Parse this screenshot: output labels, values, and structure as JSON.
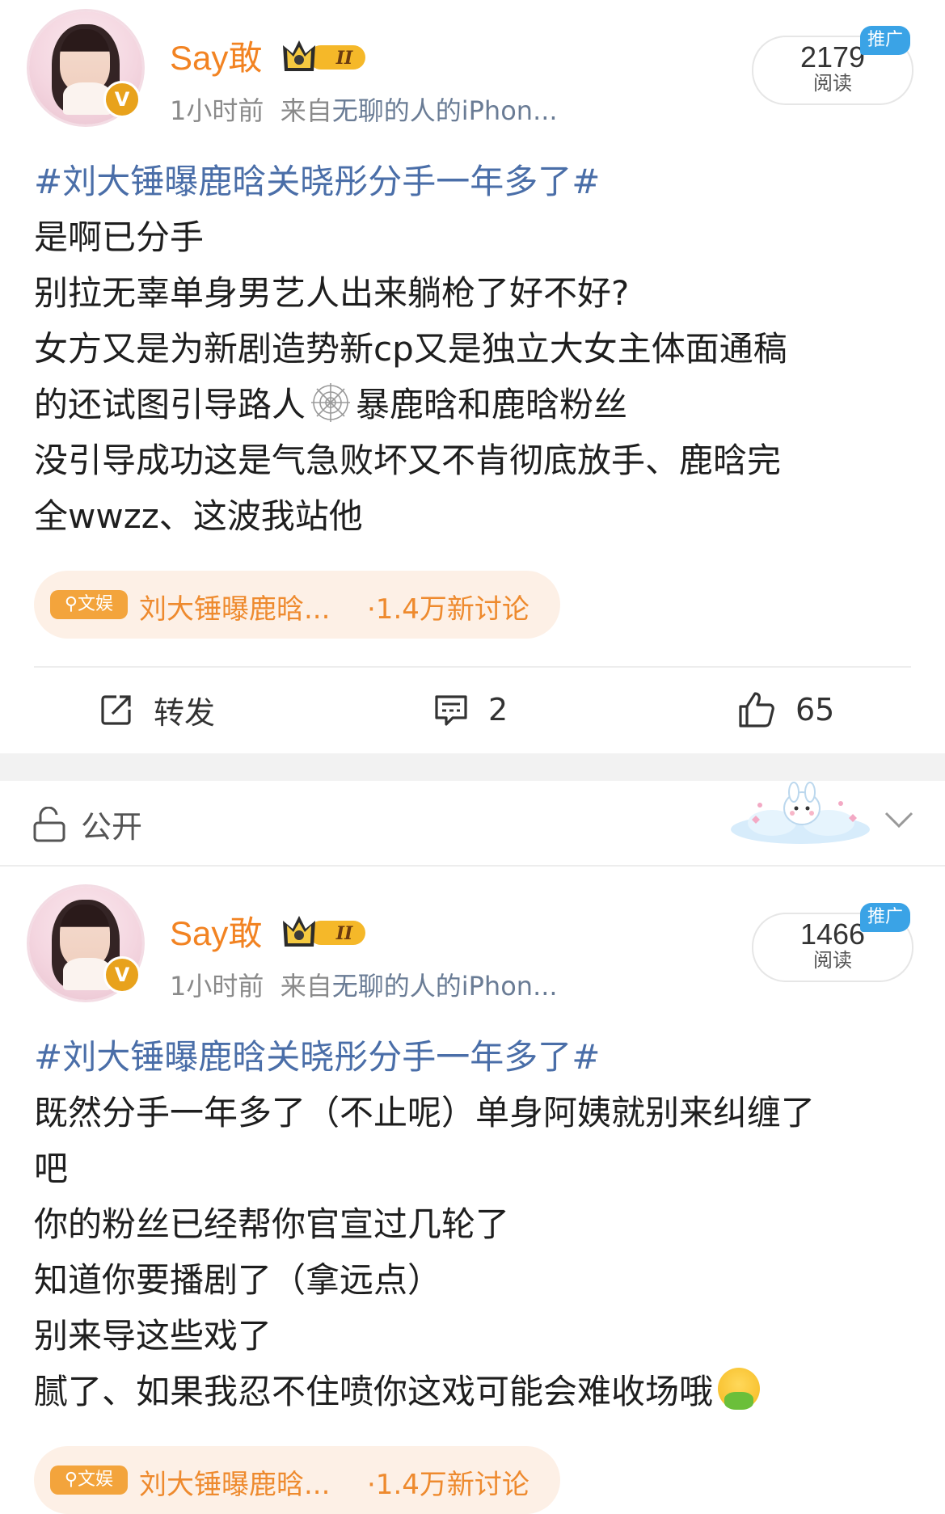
{
  "posts": [
    {
      "username": "Say敢",
      "time": "1小时前",
      "source_prefix": "来自",
      "source": "无聊的人的iPhon...",
      "reads": "2179",
      "reads_label": "阅读",
      "promo_label": "推广",
      "lines": [
        "#刘大锤曝鹿晗关晓彤分手一年多了#",
        "是啊已分手",
        "别拉无辜单身男艺人出来躺枪了好不好?",
        "女方又是为新剧造势新cp又是独立大女主体面通稿",
        "的还试图引导路人",
        "暴鹿晗和鹿晗粉丝",
        "没引导成功这是气急败坏又不肯彻底放手、鹿晗完",
        "全wwzz、这波我站他"
      ],
      "topic_tag": "文娱",
      "topic_text": "刘大锤曝鹿晗...",
      "topic_count": "·1.4万新讨论",
      "repost_label": "转发",
      "comment_count": "2",
      "like_count": "65"
    },
    {
      "username": "Say敢",
      "time": "1小时前",
      "source_prefix": "来自",
      "source": "无聊的人的iPhon...",
      "reads": "1466",
      "reads_label": "阅读",
      "promo_label": "推广",
      "lines": [
        "#刘大锤曝鹿晗关晓彤分手一年多了#",
        "既然分手一年多了（不止呢）单身阿姨就别来纠缠了",
        "吧",
        "你的粉丝已经帮你官宣过几轮了",
        "知道你要播剧了（拿远点）",
        "别来导这些戏了",
        "腻了、如果我忍不住喷你这戏可能会难收场哦"
      ],
      "topic_tag": "文娱",
      "topic_text": "刘大锤曝鹿晗...",
      "topic_count": "·1.4万新讨论"
    }
  ],
  "visibility_label": "公开",
  "icons": {
    "verified": "v-badge-icon",
    "crown": "vip-crown-badge-icon",
    "repost": "repost-icon",
    "comment": "comment-icon",
    "like": "thumbs-up-icon",
    "lock": "unlock-icon",
    "web": "spider-web-emoji-icon",
    "sick": "vomiting-face-emoji-icon"
  },
  "colors": {
    "username": "#f28322",
    "hashtag": "#4a6ea8",
    "topic": "#ee8a2e",
    "promo": "#3aa3e6"
  }
}
